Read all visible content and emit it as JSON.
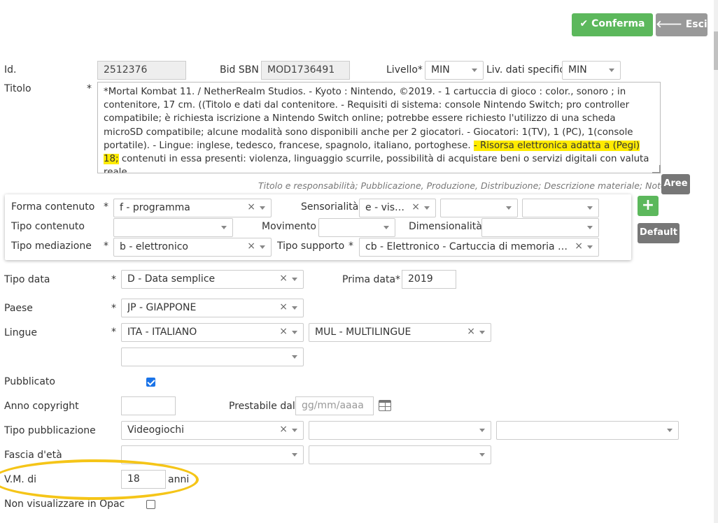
{
  "toolbar": {
    "confirm_label": "Conferma",
    "exit_label": "Esci"
  },
  "header": {
    "id_label": "Id.",
    "id_value": "2512376",
    "bid_label": "Bid SBN",
    "bid_value": "MOD1736491",
    "livello_label": "Livello*",
    "livello_value": "MIN",
    "livdati_label": "Liv. dati specifici",
    "livdati_value": "MIN"
  },
  "titolo": {
    "label": "Titolo",
    "text_before": "*Mortal Kombat 11. / NetherRealm Studios. - Kyoto : Nintendo, ©2019. - 1 cartuccia di gioco : color., sonoro ; in contenitore, 17 cm. ((Titolo e dati dal contenitore. - Requisiti di sistema: console Nintendo Switch; pro controller compatibile; è richiesta iscrizione a Nintendo Switch online; potrebbe essere richiesto l'utilizzo di una scheda microSD compatibile; alcune modalità sono disponibili anche per 2 giocatori. - Giocatori: 1(TV), 1 (PC), 1(console portatile). - Lingue: inglese, tedesco, francese, spagnolo, italiano, portoghese. ",
    "text_highlight": "- Risorsa elettronica adatta a (Pegi) 18;",
    "text_after": " contenuti in essa presenti: violenza, linguaggio scurrile, possibilità di acquistare beni o servizi digitali con valuta reale",
    "hint": "Titolo e responsabilità; Pubblicazione, Produzione, Distribuzione; Descrizione materiale; Note",
    "aree_label": "Aree"
  },
  "panel": {
    "forma_label": "Forma contenuto",
    "forma_value": "f - programma",
    "sens_label": "Sensorialità",
    "sens_value": "e - visivo",
    "tipocont_label": "Tipo contenuto",
    "mov_label": "Movimento",
    "dim_label": "Dimensionalità",
    "med_label": "Tipo mediazione",
    "med_value": "b - elettronico",
    "supp_label": "Tipo supporto",
    "supp_value": "cb - Elettronico - Cartuccia di memoria per computer",
    "default_label": "Default"
  },
  "form": {
    "tipodata_label": "Tipo data",
    "tipodata_value": "D - Data semplice",
    "primadata_label": "Prima data*",
    "primadata_value": "2019",
    "paese_label": "Paese",
    "paese_value": "JP - GIAPPONE",
    "lingue_label": "Lingue",
    "lingua1_value": "ITA - ITALIANO",
    "lingua2_value": "MUL - MULTILINGUE",
    "pubblicato_label": "Pubblicato",
    "anno_label": "Anno copyright",
    "prestabile_label": "Prestabile dal",
    "prestabile_placeholder": "gg/mm/aaaa",
    "tipopub_label": "Tipo pubblicazione",
    "tipopub_value": "Videogiochi",
    "fascia_label": "Fascia d'età",
    "vm_label": "V.M. di",
    "vm_value": "18",
    "vm_unit": "anni",
    "opac_label": "Non visualizzare in Opac"
  },
  "colors": {
    "success": "#5cb85c",
    "grey_btn": "#999999",
    "annotation": "#f5c518",
    "highlight": "#ffeb00"
  }
}
